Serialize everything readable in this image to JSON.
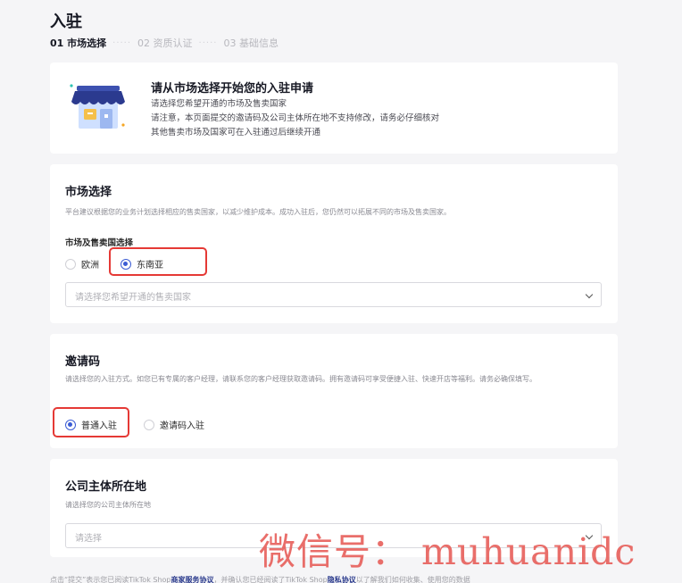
{
  "header": {
    "title": "入驻",
    "steps": [
      {
        "label": "01 市场选择",
        "active": true
      },
      {
        "label": "02 资质认证",
        "active": false
      },
      {
        "label": "03 基础信息",
        "active": false
      }
    ],
    "step_separator": "·····"
  },
  "intro": {
    "icon": "storefront-icon",
    "title": "请从市场选择开始您的入驻申请",
    "lines": [
      "请选择您希望开通的市场及售卖国家",
      "请注意，本页面提交的邀请码及公司主体所在地不支持修改，请务必仔细核对",
      "其他售卖市场及国家可在入驻通过后继续开通"
    ]
  },
  "market": {
    "title": "市场选择",
    "description": "平台建议根据您的业务计划选择相应的售卖国家，以减少维护成本。成功入驻后，您仍然可以拓展不同的市场及售卖国家。",
    "sub_label": "市场及售卖国选择",
    "options": [
      {
        "label": "欧洲",
        "checked": false
      },
      {
        "label": "东南亚",
        "checked": true
      }
    ],
    "select_placeholder": "请选择您希望开通的售卖国家"
  },
  "invite": {
    "title": "邀请码",
    "description": "请选择您的入驻方式。如您已有专属的客户经理，请联系您的客户经理获取邀请码。拥有邀请码可享受便捷入驻、快速开店等福利。请务必确保填写。",
    "options": [
      {
        "label": "普通入驻",
        "checked": true
      },
      {
        "label": "邀请码入驻",
        "checked": false
      }
    ]
  },
  "company": {
    "title": "公司主体所在地",
    "description": "请选择您的公司主体所在地",
    "select_placeholder": "请选择"
  },
  "footer": {
    "text_before": "点击“提交”表示您已阅读TikTok Shop",
    "link1": "商家服务协议",
    "text_middle": "，并确认您已经阅读了TikTok Shop",
    "link2": "隐私协议",
    "text_after": "以了解我们如何收集、使用您的数据"
  },
  "watermark": "微信号： muhuanidc",
  "colors": {
    "accent": "#3b5cd4",
    "highlight_box": "#e53935",
    "watermark": "#e65a55"
  }
}
